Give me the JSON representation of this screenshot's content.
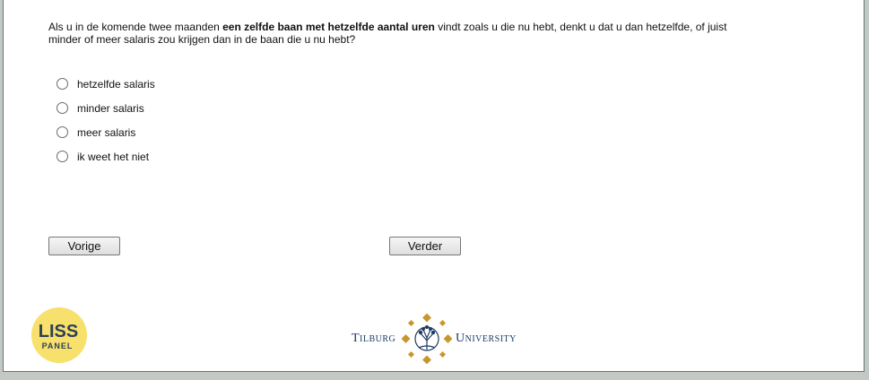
{
  "question": {
    "part1": "Als u in de komende twee maanden ",
    "bold": "een zelfde baan met hetzelfde aantal uren",
    "part2": " vindt zoals u die nu hebt, denkt u dat u dan hetzelfde, of juist minder of meer salaris zou krijgen dan in de baan die u nu hebt?"
  },
  "options": [
    {
      "label": "hetzelfde salaris"
    },
    {
      "label": "minder salaris"
    },
    {
      "label": "meer salaris"
    },
    {
      "label": "ik weet het niet"
    }
  ],
  "buttons": {
    "prev_label": "Vorige",
    "next_label": "Verder"
  },
  "logos": {
    "liss_line1": "LISS",
    "liss_line2": "PANEL",
    "tilburg_left": "Tilburg",
    "tilburg_right": "University"
  },
  "colors": {
    "liss_yellow": "#f7e06b",
    "liss_text": "#2e3f59",
    "tilburg_blue": "#1f3b63",
    "tilburg_gold": "#c8962e"
  }
}
